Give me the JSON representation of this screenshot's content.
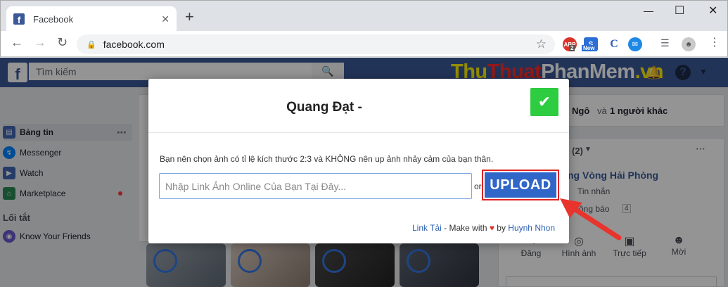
{
  "browser": {
    "tab_title": "Facebook",
    "tab_close": "✕",
    "new_tab": "+",
    "url": "facebook.com",
    "extensions": [
      {
        "name": "adblock",
        "label": "ABP",
        "badge": "2",
        "color": "#d9342b"
      },
      {
        "name": "new-extension",
        "label": "S",
        "badge": "New",
        "color": "#2b6fd6"
      },
      {
        "name": "c-extension",
        "label": "C",
        "color": "#2b5fb3"
      },
      {
        "name": "messenger-extension",
        "label": "✉",
        "color": "#1e88e5"
      }
    ]
  },
  "facebook": {
    "logo": "f",
    "search_placeholder": "Tìm kiếm",
    "watermark": {
      "part1": "Thu",
      "part2": "Thuat",
      "part3": "PhanMem",
      "part4": ".vn"
    },
    "sidebar": {
      "items": [
        {
          "label": "Bảng tin",
          "icon": "news-feed-icon",
          "color": "#4267b2"
        },
        {
          "label": "Messenger",
          "icon": "messenger-icon",
          "color": "#0084ff"
        },
        {
          "label": "Watch",
          "icon": "watch-icon",
          "color": "#4267b2"
        },
        {
          "label": "Marketplace",
          "icon": "marketplace-icon",
          "color": "#2e8b57"
        }
      ],
      "shortcuts_heading": "Lối tắt",
      "shortcuts": [
        {
          "label": "Know Your Friends",
          "icon": "app-icon",
          "color": "#6a5acd"
        }
      ]
    },
    "right": {
      "friends_text_1": "Ngô",
      "friends_text_2": "và",
      "friends_text_3": "1 người khác",
      "page_count": "(2)",
      "page_name": "ng Vòng Hải Phòng",
      "messages": "Tin nhắn",
      "notifications": "Thông báo",
      "notifications_count": "4",
      "actions": [
        {
          "label": "Đăng",
          "icon": "post-icon"
        },
        {
          "label": "Hình ảnh",
          "icon": "camera-icon"
        },
        {
          "label": "Trực tiếp",
          "icon": "live-video-icon"
        },
        {
          "label": "Mời",
          "icon": "invite-icon"
        }
      ]
    }
  },
  "modal": {
    "title": "Quang Đạt -",
    "check_icon": "✔",
    "description": "Bạn nên chọn ảnh có tỉ lệ kích thước 2:3 và KHÔNG nên up ảnh nhảy cảm của bạn thân.",
    "input_placeholder": "Nhập Link Ảnh Online Của Bạn Tại Đây...",
    "or_label": "or",
    "upload_label": "UPLOAD",
    "footer": {
      "link_download": "Link Tải",
      "made_with": " - Make with ",
      "heart": "♥",
      "by": " by ",
      "author": "Huynh Nhon"
    }
  }
}
